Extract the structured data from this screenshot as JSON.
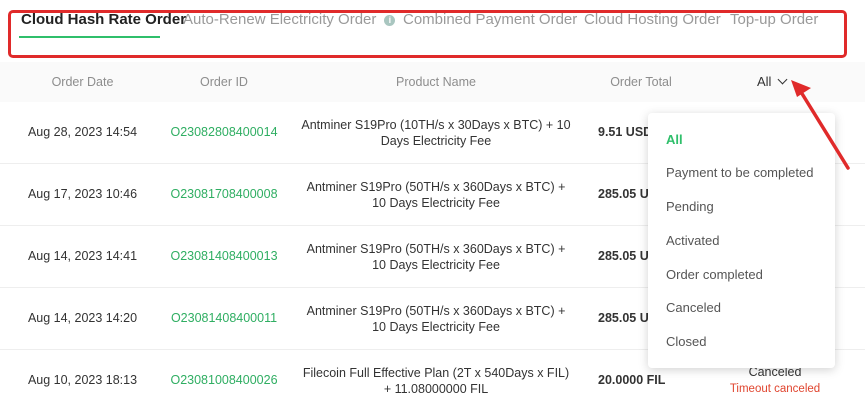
{
  "tabs": [
    {
      "label": "Cloud Hash Rate Order",
      "active": true
    },
    {
      "label": "Auto-Renew Electricity Order",
      "active": false,
      "icon": "info-icon"
    },
    {
      "label": "Combined Payment Order",
      "active": false
    },
    {
      "label": "Cloud Hosting Order",
      "active": false
    },
    {
      "label": "Top-up Order",
      "active": false
    }
  ],
  "table": {
    "headers": {
      "date": "Order Date",
      "id": "Order ID",
      "product": "Product Name",
      "total": "Order Total",
      "status_filter": "All"
    },
    "rows": [
      {
        "date": "Aug 28, 2023 14:54",
        "id": "O23082808400014",
        "product_line1": "Antminer S19Pro (10TH/s x 30Days x BTC) + 10",
        "product_line2": "Days Electricity Fee",
        "total": "9.51 USDT",
        "status": "",
        "status_sub": ""
      },
      {
        "date": "Aug 17, 2023 10:46",
        "id": "O23081708400008",
        "product_line1": "Antminer S19Pro (50TH/s x 360Days x BTC) +",
        "product_line2": "10 Days Electricity Fee",
        "total": "285.05 USDT",
        "status": "",
        "status_sub": ""
      },
      {
        "date": "Aug 14, 2023 14:41",
        "id": "O23081408400013",
        "product_line1": "Antminer S19Pro (50TH/s x 360Days x BTC) +",
        "product_line2": "10 Days Electricity Fee",
        "total": "285.05 USDT",
        "status": "",
        "status_sub": ""
      },
      {
        "date": "Aug 14, 2023 14:20",
        "id": "O23081408400011",
        "product_line1": "Antminer S19Pro (50TH/s x 360Days x BTC) +",
        "product_line2": "10 Days Electricity Fee",
        "total": "285.05 USDT",
        "status": "",
        "status_sub": ""
      },
      {
        "date": "Aug 10, 2023 18:13",
        "id": "O23081008400026",
        "product_line1": "Filecoin Full Effective Plan (2T x 540Days x FIL)",
        "product_line2": "+ 11.08000000 FIL",
        "total": "20.0000 FIL",
        "status": "Canceled",
        "status_sub": "Timeout canceled"
      }
    ]
  },
  "status_dropdown": {
    "selected": "All",
    "options": [
      "All",
      "Payment to be completed",
      "Pending",
      "Activated",
      "Order completed",
      "Canceled",
      "Closed"
    ]
  },
  "colors": {
    "accent_green": "#2fbf6b",
    "order_id_green": "#2fae62",
    "annotation_red": "#e02a2a",
    "cancel_red": "#e0452f"
  }
}
